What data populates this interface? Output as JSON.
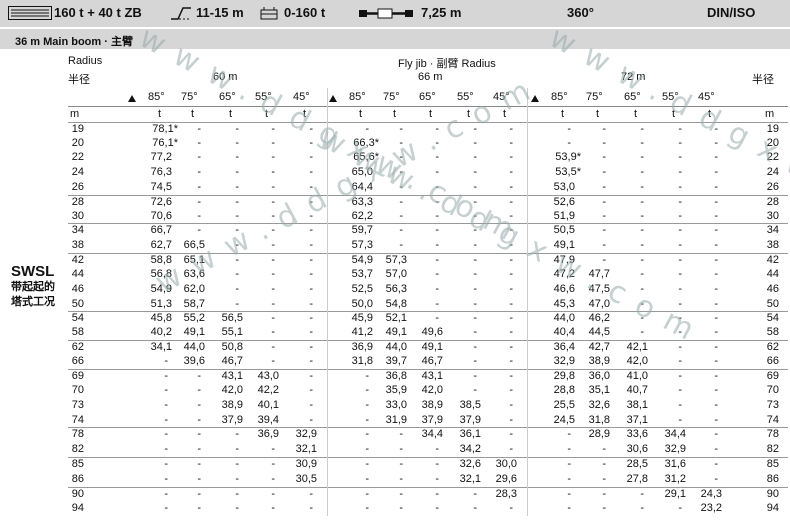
{
  "header": {
    "capacity": "160 t + 40 t ZB",
    "boom_range": "11-15 m",
    "counterweight": "0-160 t",
    "outrigger": "7,25 m",
    "slew": "360°",
    "standard": "DIN/ISO"
  },
  "subheader": {
    "text": "36 m  Main boom · 主臂"
  },
  "table_header": {
    "radius_en": "Radius",
    "radius_cn": "半径",
    "radius_cn_right": "半径",
    "flyjib": "Fly jib · 副臂 Radius",
    "jib_lengths": [
      "60 m",
      "66 m",
      "72 m"
    ],
    "angles": [
      "85°",
      "75°",
      "65°",
      "55°",
      "45°"
    ],
    "unit_m": "m",
    "unit_t": "t"
  },
  "side_label": {
    "main": "SWSL",
    "line1": "带起起的",
    "line2": "塔式工况"
  },
  "rows": [
    {
      "r": "19",
      "v": [
        "78,1*",
        "-",
        "-",
        "-",
        "-",
        "-",
        "-",
        "-",
        "-",
        "-",
        "-",
        "-",
        "-",
        "-",
        "-"
      ]
    },
    {
      "r": "20",
      "v": [
        "76,1*",
        "-",
        "-",
        "-",
        "-",
        "66,3*",
        "-",
        "-",
        "-",
        "-",
        "-",
        "-",
        "-",
        "-",
        "-"
      ]
    },
    {
      "r": "22",
      "v": [
        "77,2",
        "-",
        "-",
        "-",
        "-",
        "65,6*",
        "-",
        "-",
        "-",
        "-",
        "53,9*",
        "-",
        "-",
        "-",
        "-"
      ]
    },
    {
      "r": "24",
      "v": [
        "76,3",
        "-",
        "-",
        "-",
        "-",
        "65,0",
        "-",
        "-",
        "-",
        "-",
        "53,5*",
        "-",
        "-",
        "-",
        "-"
      ]
    },
    {
      "r": "26",
      "v": [
        "74,5",
        "-",
        "-",
        "-",
        "-",
        "64,4",
        "-",
        "-",
        "-",
        "-",
        "53,0",
        "-",
        "-",
        "-",
        "-"
      ]
    },
    {
      "r": "28",
      "v": [
        "72,6",
        "-",
        "-",
        "-",
        "-",
        "63,3",
        "-",
        "-",
        "-",
        "-",
        "52,6",
        "-",
        "-",
        "-",
        "-"
      ]
    },
    {
      "r": "30",
      "v": [
        "70,6",
        "-",
        "-",
        "-",
        "-",
        "62,2",
        "-",
        "-",
        "-",
        "-",
        "51,9",
        "-",
        "-",
        "-",
        "-"
      ]
    },
    {
      "r": "34",
      "v": [
        "66,7",
        "-",
        "-",
        "-",
        "-",
        "59,7",
        "-",
        "-",
        "-",
        "-",
        "50,5",
        "-",
        "-",
        "-",
        "-"
      ]
    },
    {
      "r": "38",
      "v": [
        "62,7",
        "66,5",
        "-",
        "-",
        "-",
        "57,3",
        "-",
        "-",
        "-",
        "-",
        "49,1",
        "-",
        "-",
        "-",
        "-"
      ]
    },
    {
      "r": "42",
      "v": [
        "58,8",
        "65,1",
        "-",
        "-",
        "-",
        "54,9",
        "57,3",
        "-",
        "-",
        "-",
        "47,9",
        "-",
        "-",
        "-",
        "-"
      ]
    },
    {
      "r": "44",
      "v": [
        "56,8",
        "63,6",
        "-",
        "-",
        "-",
        "53,7",
        "57,0",
        "-",
        "-",
        "-",
        "47,2",
        "47,7",
        "-",
        "-",
        "-"
      ]
    },
    {
      "r": "46",
      "v": [
        "54,9",
        "62,0",
        "-",
        "-",
        "-",
        "52,5",
        "56,3",
        "-",
        "-",
        "-",
        "46,6",
        "47,5",
        "-",
        "-",
        "-"
      ]
    },
    {
      "r": "50",
      "v": [
        "51,3",
        "58,7",
        "-",
        "-",
        "-",
        "50,0",
        "54,8",
        "-",
        "-",
        "-",
        "45,3",
        "47,0",
        "-",
        "-",
        "-"
      ]
    },
    {
      "r": "54",
      "v": [
        "45,8",
        "55,2",
        "56,5",
        "-",
        "-",
        "45,9",
        "52,1",
        "-",
        "-",
        "-",
        "44,0",
        "46,2",
        "-",
        "-",
        "-"
      ]
    },
    {
      "r": "58",
      "v": [
        "40,2",
        "49,1",
        "55,1",
        "-",
        "-",
        "41,2",
        "49,1",
        "49,6",
        "-",
        "-",
        "40,4",
        "44,5",
        "-",
        "-",
        "-"
      ]
    },
    {
      "r": "62",
      "v": [
        "34,1",
        "44,0",
        "50,8",
        "-",
        "-",
        "36,9",
        "44,0",
        "49,1",
        "-",
        "-",
        "36,4",
        "42,7",
        "42,1",
        "-",
        "-"
      ]
    },
    {
      "r": "66",
      "v": [
        "-",
        "39,6",
        "46,7",
        "-",
        "-",
        "31,8",
        "39,7",
        "46,7",
        "-",
        "-",
        "32,9",
        "38,9",
        "42,0",
        "-",
        "-"
      ]
    },
    {
      "r": "69",
      "v": [
        "-",
        "-",
        "43,1",
        "43,0",
        "-",
        "-",
        "36,8",
        "43,1",
        "-",
        "-",
        "29,8",
        "36,0",
        "41,0",
        "-",
        "-"
      ]
    },
    {
      "r": "70",
      "v": [
        "-",
        "-",
        "42,0",
        "42,2",
        "-",
        "-",
        "35,9",
        "42,0",
        "-",
        "-",
        "28,8",
        "35,1",
        "40,7",
        "-",
        "-"
      ]
    },
    {
      "r": "73",
      "v": [
        "-",
        "-",
        "38,9",
        "40,1",
        "-",
        "-",
        "33,0",
        "38,9",
        "38,5",
        "-",
        "25,5",
        "32,6",
        "38,1",
        "-",
        "-"
      ]
    },
    {
      "r": "74",
      "v": [
        "-",
        "-",
        "37,9",
        "39,4",
        "-",
        "-",
        "31,9",
        "37,9",
        "37,9",
        "-",
        "24,5",
        "31,8",
        "37,1",
        "-",
        "-"
      ]
    },
    {
      "r": "78",
      "v": [
        "-",
        "-",
        "-",
        "36,9",
        "32,9",
        "-",
        "-",
        "34,4",
        "36,1",
        "-",
        "-",
        "28,9",
        "33,6",
        "34,4",
        "-"
      ]
    },
    {
      "r": "82",
      "v": [
        "-",
        "-",
        "-",
        "-",
        "32,1",
        "-",
        "-",
        "-",
        "34,2",
        "-",
        "-",
        "-",
        "30,6",
        "32,9",
        "-"
      ]
    },
    {
      "r": "85",
      "v": [
        "-",
        "-",
        "-",
        "-",
        "30,9",
        "-",
        "-",
        "-",
        "32,6",
        "30,0",
        "-",
        "-",
        "28,5",
        "31,6",
        "-"
      ]
    },
    {
      "r": "86",
      "v": [
        "-",
        "-",
        "-",
        "-",
        "30,5",
        "-",
        "-",
        "-",
        "32,1",
        "29,6",
        "-",
        "-",
        "27,8",
        "31,2",
        "-"
      ]
    },
    {
      "r": "90",
      "v": [
        "-",
        "-",
        "-",
        "-",
        "-",
        "-",
        "-",
        "-",
        "-",
        "28,3",
        "-",
        "-",
        "-",
        "29,1",
        "24,3"
      ]
    },
    {
      "r": "94",
      "v": [
        "-",
        "-",
        "-",
        "-",
        "-",
        "-",
        "-",
        "-",
        "-",
        "-",
        "-",
        "-",
        "-",
        "-",
        "23,2"
      ]
    }
  ],
  "watermark": "www.ddgxw.com"
}
